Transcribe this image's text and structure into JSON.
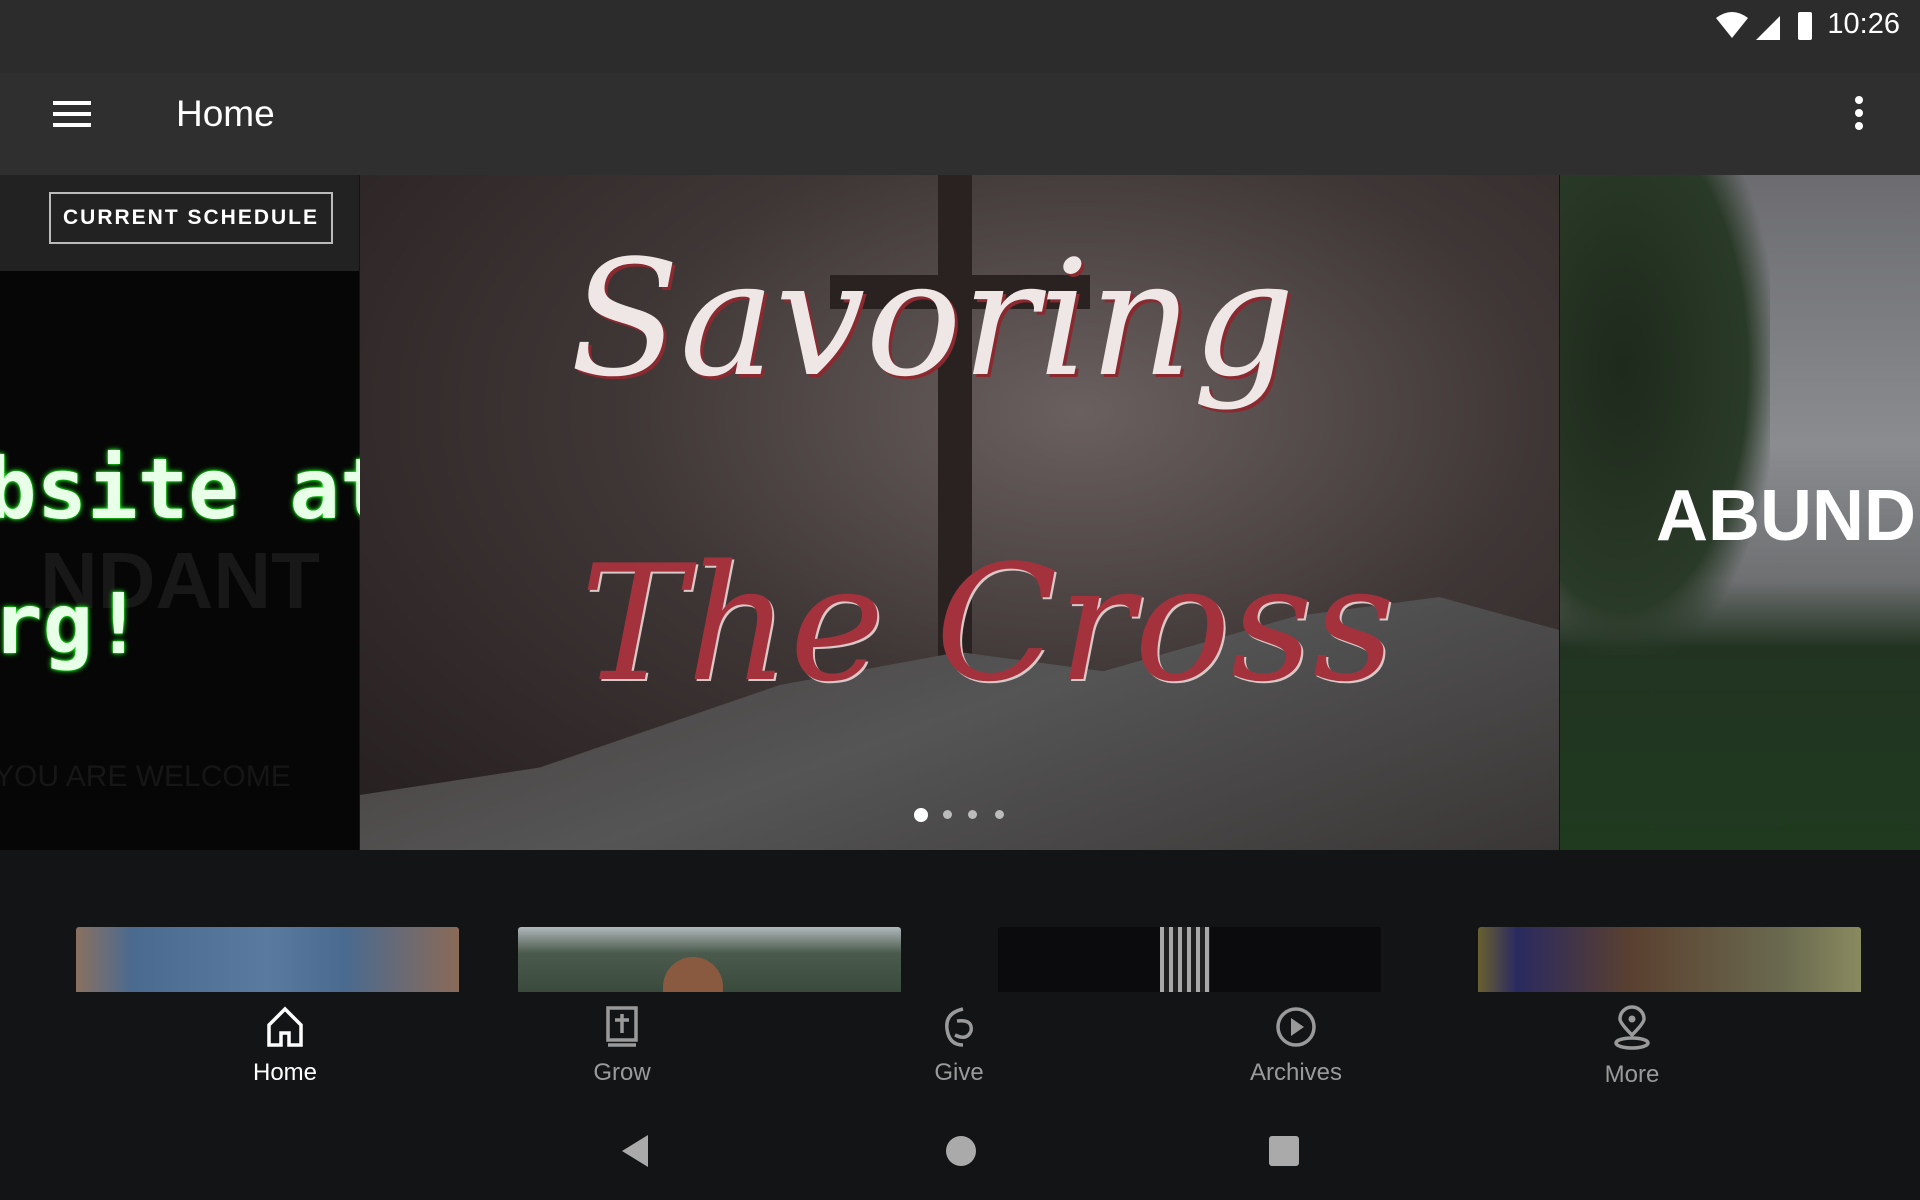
{
  "status_bar": {
    "time": "10:26",
    "icons": [
      "wifi-icon",
      "signal-icon",
      "battery-icon"
    ]
  },
  "app_bar": {
    "title": "Home",
    "menu_icon": "hamburger-icon",
    "overflow_icon": "more-vert-icon"
  },
  "carousel": {
    "slides": [
      {
        "button": "CURRENT SCHEDULE",
        "line1": "bsite at",
        "line2": "rg!",
        "faint1": "NDANT",
        "faint2": "YOU ARE WELCOME"
      },
      {
        "title_line1": "Savoring",
        "title_line2": "The Cross"
      },
      {
        "title": "ABUND"
      }
    ],
    "dot_count": 4,
    "active_dot": 0
  },
  "bottom_nav": {
    "items": [
      {
        "label": "Home",
        "icon": "home-icon",
        "active": true
      },
      {
        "label": "Grow",
        "icon": "bible-icon",
        "active": false
      },
      {
        "label": "Give",
        "icon": "give-icon",
        "active": false
      },
      {
        "label": "Archives",
        "icon": "play-circle-icon",
        "active": false
      },
      {
        "label": "More",
        "icon": "location-pin-icon",
        "active": false
      }
    ]
  },
  "system_nav": [
    "back-icon",
    "home-circle-icon",
    "recents-icon"
  ],
  "colors": {
    "background": "#121416",
    "app_bar": "#2f2f2f",
    "accent_green": "#22ff22",
    "title_red": "#a4323c"
  }
}
